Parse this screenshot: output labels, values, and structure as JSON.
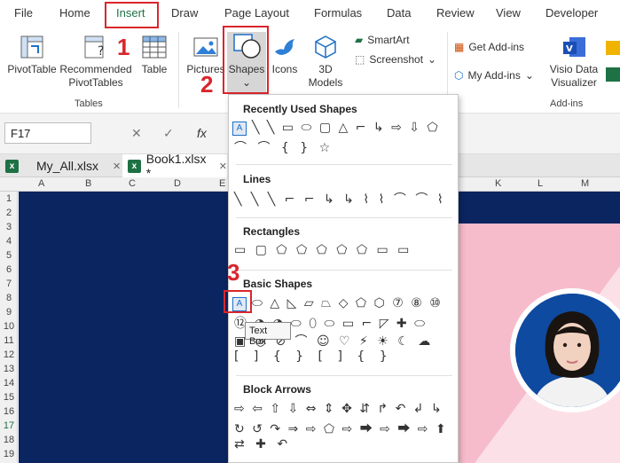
{
  "ribbon_tabs": [
    "File",
    "Home",
    "Insert",
    "Draw",
    "Page Layout",
    "Formulas",
    "Data",
    "Review",
    "View",
    "Developer"
  ],
  "ribbon": {
    "pivot_table": "PivotTable",
    "recommended_line1": "Recommended",
    "recommended_line2": "PivotTables",
    "table": "Table",
    "tables_group": "Tables",
    "pictures": "Pictures",
    "shapes": "Shapes",
    "icons": "Icons",
    "models_line1": "3D",
    "models_line2": "Models",
    "smartart": "SmartArt",
    "screenshot": "Screenshot",
    "get_addins": "Get Add-ins",
    "my_addins": "My Add-ins",
    "visio_line1": "Visio Data",
    "visio_line2": "Visualizer",
    "addins_group": "Add-ins"
  },
  "steps": [
    "1",
    "2",
    "3"
  ],
  "formula_bar": {
    "name_box": "F17",
    "fx": "fx",
    "cancel": "✕",
    "enter": "✓"
  },
  "file_tabs": [
    {
      "name": "My_All.xlsx",
      "close": "✕"
    },
    {
      "name": "Book1.xlsx *",
      "close": "✕"
    }
  ],
  "columns": [
    "A",
    "B",
    "C",
    "D",
    "E",
    "K",
    "L",
    "M"
  ],
  "rows": [
    "1",
    "2",
    "3",
    "4",
    "5",
    "6",
    "7",
    "8",
    "9",
    "10",
    "11",
    "12",
    "13",
    "14",
    "15",
    "16",
    "17",
    "18",
    "19"
  ],
  "shapes_menu": {
    "recently_used": "Recently Used Shapes",
    "lines": "Lines",
    "rectangles": "Rectangles",
    "basic": "Basic Shapes",
    "block_arrows": "Block Arrows",
    "recent_glyphs": "╲ ╲ ▭ ⬭ ▢ △ ⌐ ↳ ⇨ ⇩ ⬠",
    "recent_glyphs2": "⌒ ⌒ { } ☆",
    "line_glyphs": "╲ ╲ ╲ ⌐ ⌐ ↳ ↳ ⌇ ⌇ ⌒ ⌒ ⌇",
    "rect_glyphs": "▭ ▢ ⬠ ⬠ ⬠ ⬠ ⬠ ▭ ▭",
    "basic_row1": "⬭ △ ◺ ▱ ⏢ ◇ ⬠ ⬡ ⑦ ⑧ ⑩",
    "basic_row2": "⑫ ◔ ◑ ⬭ ⬯ ⬭ ▭ ⌐ ◸ ✚ ⬭",
    "basic_row3": "▣ ◎ ⊘ ⌒ ☺ ♡ ⚡ ☀ ☾ ☁",
    "basic_row4": "[ ] { } [ ] { }",
    "arrow_row1": "⇨ ⇦ ⇧ ⇩ ⇔ ⇕ ✥ ⇵ ↱ ↶ ↲ ↳",
    "arrow_row2": "↻ ↺ ↷ ⇒ ⇨ ⬠ ⇨ ⮕ ⇨ ⮕ ⇨ ⬆",
    "arrow_row3": "⇄ ✚ ↶",
    "tooltip": "Text Box"
  }
}
